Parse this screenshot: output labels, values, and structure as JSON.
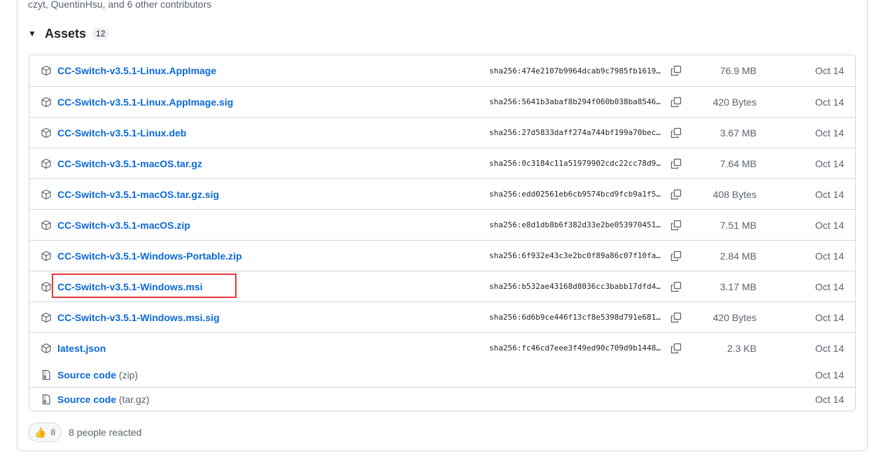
{
  "contributors_text": "czyt, QuentinHsu, and 6 other contributors",
  "assets": {
    "title": "Assets",
    "count": "12",
    "files": [
      {
        "name": "CC-Switch-v3.5.1-Linux.AppImage",
        "sha": "sha256:474e2107b9964dcab9c7985fb1619…",
        "size": "76.9 MB",
        "date": "Oct 14"
      },
      {
        "name": "CC-Switch-v3.5.1-Linux.AppImage.sig",
        "sha": "sha256:5641b3abaf8b294f060b038ba8546…",
        "size": "420 Bytes",
        "date": "Oct 14"
      },
      {
        "name": "CC-Switch-v3.5.1-Linux.deb",
        "sha": "sha256:27d5833daff274a744bf199a70bec…",
        "size": "3.67 MB",
        "date": "Oct 14"
      },
      {
        "name": "CC-Switch-v3.5.1-macOS.tar.gz",
        "sha": "sha256:0c3184c11a51979902cdc22cc78d9…",
        "size": "7.64 MB",
        "date": "Oct 14"
      },
      {
        "name": "CC-Switch-v3.5.1-macOS.tar.gz.sig",
        "sha": "sha256:edd02561eb6cb9574bcd9fcb9a1f5…",
        "size": "408 Bytes",
        "date": "Oct 14"
      },
      {
        "name": "CC-Switch-v3.5.1-macOS.zip",
        "sha": "sha256:e8d1db8b6f382d33e2be053970451…",
        "size": "7.51 MB",
        "date": "Oct 14"
      },
      {
        "name": "CC-Switch-v3.5.1-Windows-Portable.zip",
        "sha": "sha256:6f932e43c3e2bc0f89a86c07f10fa…",
        "size": "2.84 MB",
        "date": "Oct 14"
      },
      {
        "name": "CC-Switch-v3.5.1-Windows.msi",
        "sha": "sha256:b532ae43168d8036cc3babb17dfd4…",
        "size": "3.17 MB",
        "date": "Oct 14"
      },
      {
        "name": "CC-Switch-v3.5.1-Windows.msi.sig",
        "sha": "sha256:6d6b9ce446f13cf8e5398d791e681…",
        "size": "420 Bytes",
        "date": "Oct 14"
      },
      {
        "name": "latest.json",
        "sha": "sha256:fc46cd7eee3f49ed90c709d9b1448…",
        "size": "2.3 KB",
        "date": "Oct 14"
      }
    ],
    "source": [
      {
        "label": "Source code",
        "format": "(zip)",
        "date": "Oct 14"
      },
      {
        "label": "Source code",
        "format": "(tar.gz)",
        "date": "Oct 14"
      }
    ]
  },
  "reactions": {
    "emoji": "👍",
    "count": "8",
    "text": "8 people reacted"
  },
  "colors": {
    "link": "#0969da",
    "muted": "#59636e",
    "border": "#d1d9e0",
    "highlight": "#e53935"
  }
}
